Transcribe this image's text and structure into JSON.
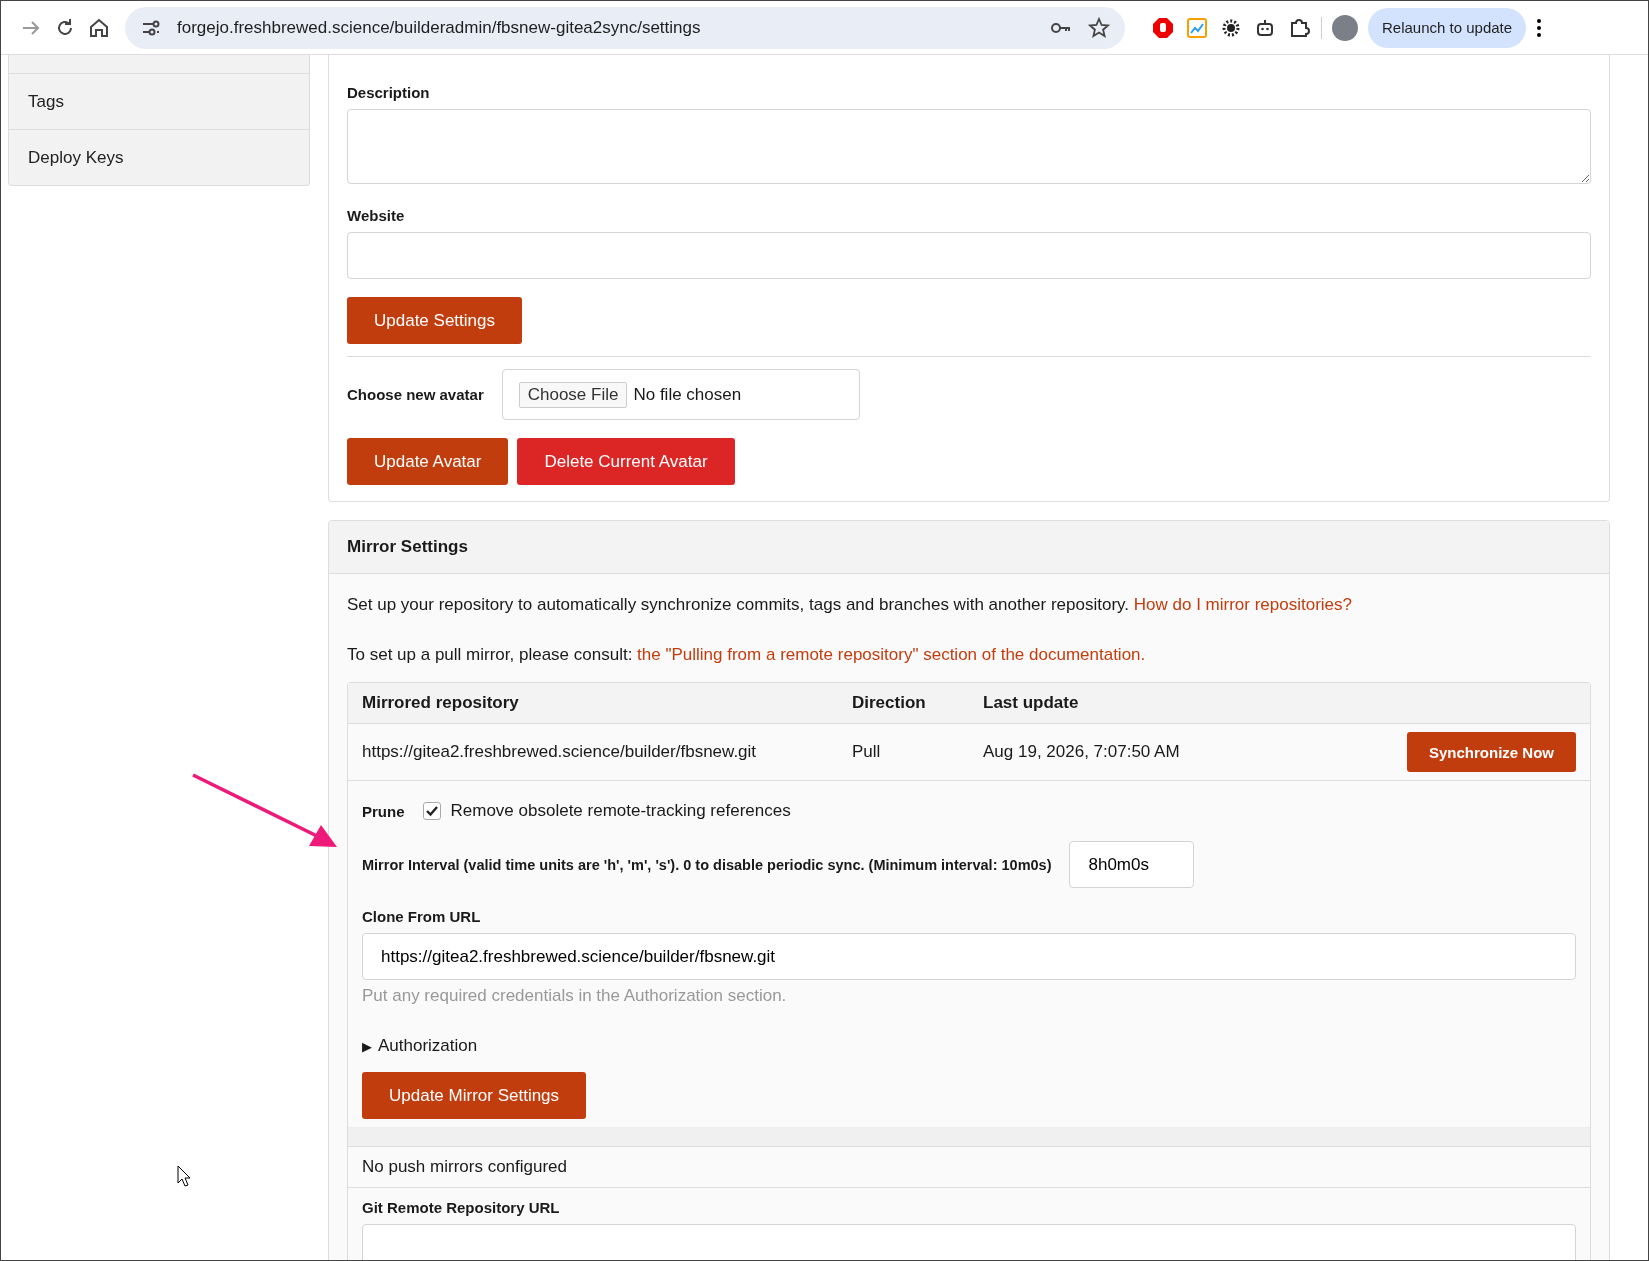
{
  "browser": {
    "url": "forgejo.freshbrewed.science/builderadmin/fbsnew-gitea2sync/settings",
    "relaunch": "Relaunch to update"
  },
  "sidebar": {
    "items": [
      {
        "label": "Tags",
        "selected": false
      },
      {
        "label": "Deploy Keys",
        "selected": false
      }
    ]
  },
  "settings": {
    "description_label": "Description",
    "website_label": "Website",
    "update_button": "Update Settings",
    "avatar_label": "Choose new avatar",
    "file_button": "Choose File",
    "file_status": "No file chosen",
    "avatar_buttons": [
      {
        "label": "Update Avatar",
        "kind": "primary"
      },
      {
        "label": "Delete Current Avatar",
        "kind": "danger"
      }
    ]
  },
  "mirror": {
    "title": "Mirror Settings",
    "intro": "Set up your repository to automatically synchronize commits, tags and branches with another repository.",
    "intro_link": "How do I mirror repositories?",
    "pull_intro": "To set up a pull mirror, please consult:",
    "pull_link": "the \"Pulling from a remote repository\" section of the documentation.",
    "table": {
      "columns": [
        "Mirrored repository",
        "Direction",
        "Last update"
      ],
      "row": {
        "repository": "https://gitea2.freshbrewed.science/builder/fbsnew.git",
        "direction": "Pull",
        "last_update": "Aug 19, 2026, 7:07:50 AM",
        "action": "Synchronize Now"
      }
    },
    "prune": {
      "label": "Prune",
      "checkbox_label": "Remove obsolete remote-tracking references",
      "checked": true
    },
    "interval_label": "Mirror Interval (valid time units are 'h', 'm', 's'). 0 to disable periodic sync. (Minimum interval: 10m0s)",
    "interval_value": "8h0m0s",
    "clone_label": "Clone From URL",
    "clone_value": "https://gitea2.freshbrewed.science/builder/fbsnew.git",
    "clone_help": "Put any required credentials in the Authorization section.",
    "authorization": {
      "icon": "▶",
      "label": "Authorization",
      "expanded": false
    },
    "update_button": "Update Mirror Settings",
    "push_status": "No push mirrors configured",
    "git_remote_label": "Git Remote Repository URL"
  }
}
